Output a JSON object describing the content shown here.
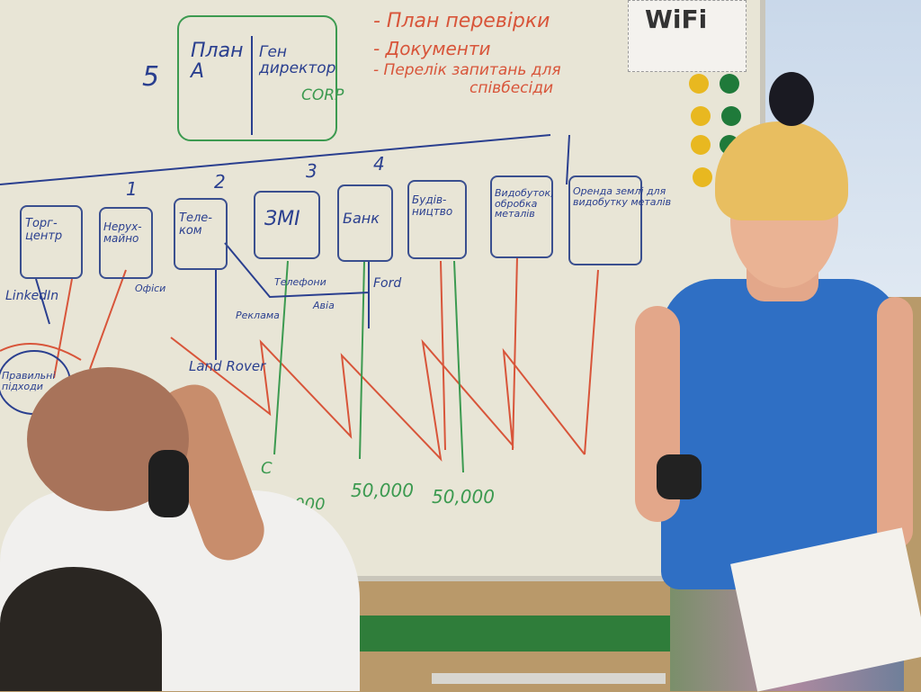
{
  "board": {
    "todo": [
      "- План перевірки",
      "- Документи",
      "- Перелік запитань для",
      "співбесіди"
    ],
    "plan_box": {
      "left": "План A",
      "right": "Ген директор",
      "corp": "CORP",
      "number": "5"
    },
    "boxes": [
      "Торг-центр",
      "Нерух-майно",
      "Теле-ком",
      "ЗМІ",
      "Банк",
      "Будів-ництво",
      "Видобуток, обробка металів",
      "Оренда землі для видобутку металів"
    ],
    "numbers": [
      "1",
      "2",
      "3",
      "4"
    ],
    "notes": {
      "linkedin": "LinkedIn",
      "offices": "Офіси",
      "advertising": "Реклама",
      "land_rover": "Land Rover",
      "phones": "Телефони",
      "ford": "Ford",
      "avia": "Авіа",
      "approaches": "Правильні підходи",
      "amount1": "0,000",
      "amount2": "50,000",
      "amount3": "50,000",
      "c": "C"
    }
  },
  "wifi_sign": {
    "label": "WiFi"
  },
  "colors": {
    "board": "#e8e5d6",
    "marker_blue": "#2a3f8f",
    "marker_red": "#d8553a",
    "marker_green": "#3c9a50",
    "shirt_blue": "#2f6fc4"
  }
}
